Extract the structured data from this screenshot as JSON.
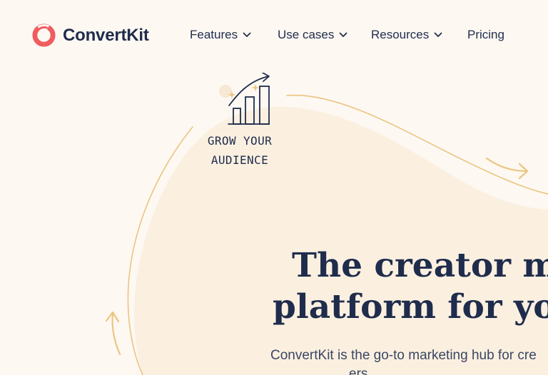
{
  "brand": {
    "name": "ConvertKit",
    "logo_icon": "convertkit-logo-icon",
    "accent_color": "#f05c5f",
    "text_color": "#1f2c4c",
    "background_color": "#fdf8f2",
    "blob_color": "#fbf0e0",
    "line_color": "#ecc47f"
  },
  "nav": {
    "items": [
      {
        "label": "Features",
        "has_dropdown": true,
        "icon": "chevron-down-icon"
      },
      {
        "label": "Use cases",
        "has_dropdown": true,
        "icon": "chevron-down-icon"
      },
      {
        "label": "Resources",
        "has_dropdown": true,
        "icon": "chevron-down-icon"
      },
      {
        "label": "Pricing",
        "has_dropdown": false
      }
    ]
  },
  "illustration": {
    "icon": "growth-bar-chart-icon",
    "label_line1": "GROW YOUR",
    "label_line2": "AUDIENCE"
  },
  "hero": {
    "title_line1": "The creator mar",
    "title_line2": "platform for your",
    "subtitle_line1": "ConvertKit is the go-to marketing hub for cre",
    "subtitle_line2": "ers"
  }
}
